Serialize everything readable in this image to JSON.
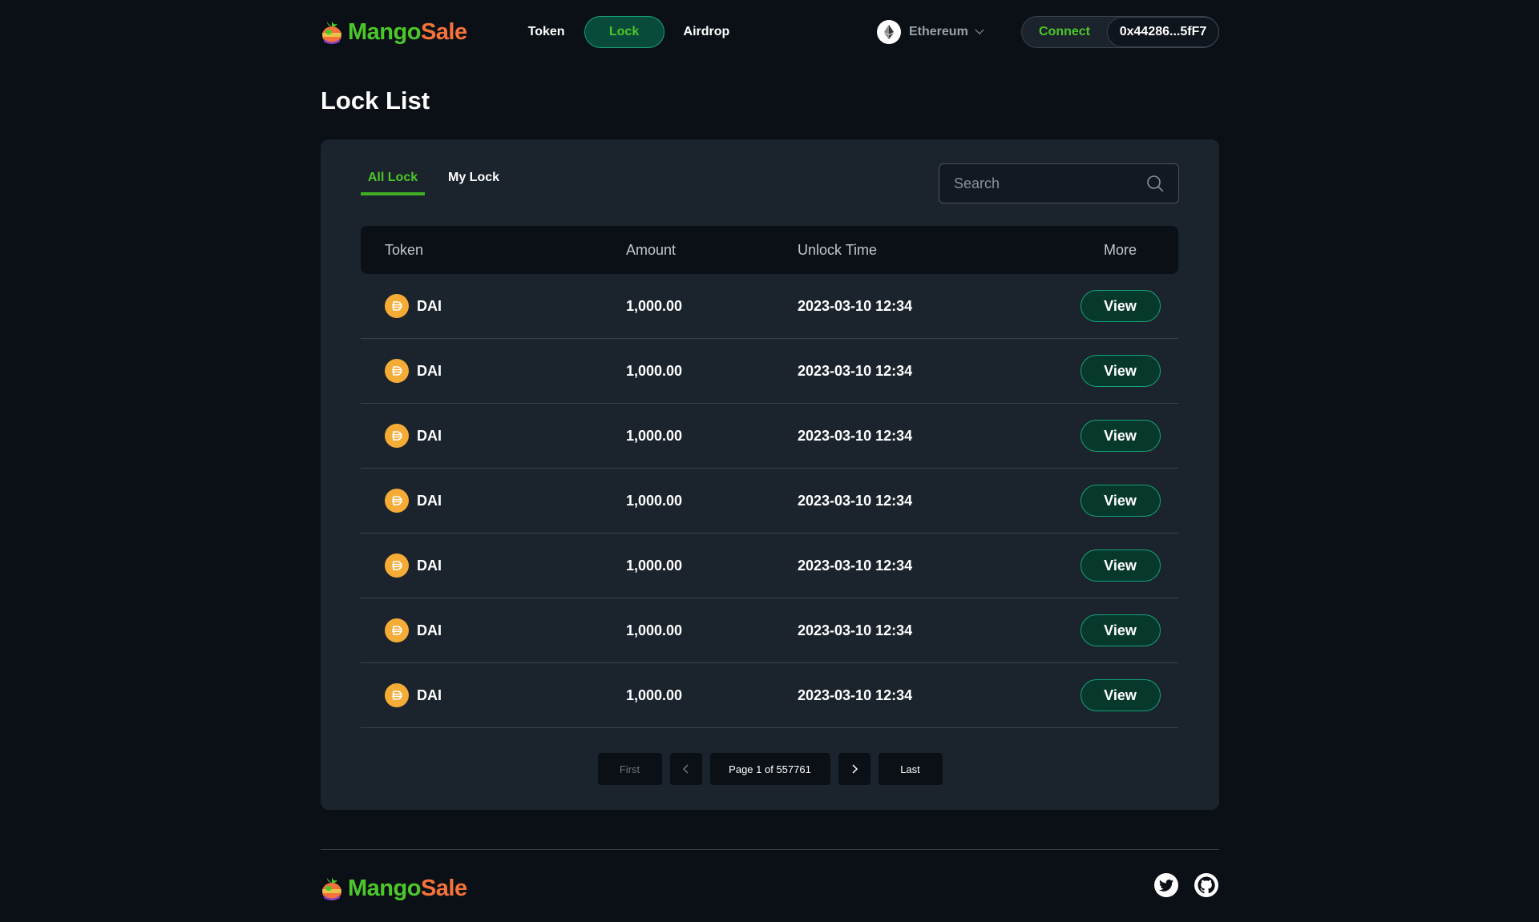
{
  "brand": {
    "name_part1": "Mango",
    "name_part2": "Sale"
  },
  "nav": {
    "items": [
      {
        "label": "Token",
        "active": false
      },
      {
        "label": "Lock",
        "active": true
      },
      {
        "label": "Airdrop",
        "active": false
      }
    ]
  },
  "network": {
    "label": "Ethereum"
  },
  "wallet": {
    "connect_label": "Connect",
    "address": "0x44286...5fF7"
  },
  "page": {
    "title": "Lock List"
  },
  "tabs": [
    {
      "label": "All Lock",
      "active": true
    },
    {
      "label": "My Lock",
      "active": false
    }
  ],
  "search": {
    "placeholder": "Search"
  },
  "table": {
    "columns": [
      "Token",
      "Amount",
      "Unlock Time",
      "More"
    ],
    "rows": [
      {
        "token": "DAI",
        "amount": "1,000.00",
        "unlock_time": "2023-03-10 12:34",
        "action": "View"
      },
      {
        "token": "DAI",
        "amount": "1,000.00",
        "unlock_time": "2023-03-10 12:34",
        "action": "View"
      },
      {
        "token": "DAI",
        "amount": "1,000.00",
        "unlock_time": "2023-03-10 12:34",
        "action": "View"
      },
      {
        "token": "DAI",
        "amount": "1,000.00",
        "unlock_time": "2023-03-10 12:34",
        "action": "View"
      },
      {
        "token": "DAI",
        "amount": "1,000.00",
        "unlock_time": "2023-03-10 12:34",
        "action": "View"
      },
      {
        "token": "DAI",
        "amount": "1,000.00",
        "unlock_time": "2023-03-10 12:34",
        "action": "View"
      },
      {
        "token": "DAI",
        "amount": "1,000.00",
        "unlock_time": "2023-03-10 12:34",
        "action": "View"
      }
    ]
  },
  "pagination": {
    "first_label": "First",
    "info": "Page 1 of 557761",
    "last_label": "Last"
  },
  "colors": {
    "background": "#0b1016",
    "card": "#1b232c",
    "accent_green": "#4cc72a",
    "brand_orange": "#f5733a",
    "button_border": "#13a37b",
    "dai_coin": "#f5ac37"
  },
  "icons": {
    "network": "ethereum-icon",
    "search": "search-icon",
    "token": "dai-icon",
    "social": [
      "twitter-icon",
      "github-icon"
    ]
  }
}
